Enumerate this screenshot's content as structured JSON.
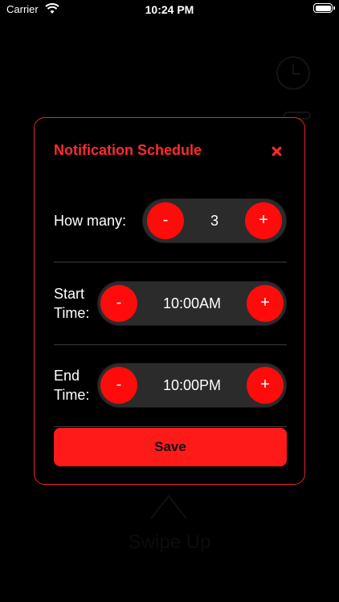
{
  "status_bar": {
    "carrier": "Carrier",
    "time": "10:24 PM"
  },
  "background": {
    "swipe_label": "Swipe Up"
  },
  "modal": {
    "title": "Notification Schedule",
    "rows": [
      {
        "label": "How many:",
        "minus": "-",
        "value": "3",
        "plus": "+"
      },
      {
        "label_line1": "Start",
        "label_line2": "Time:",
        "minus": "-",
        "value": "10:00AM",
        "plus": "+"
      },
      {
        "label_line1": "End",
        "label_line2": "Time:",
        "minus": "-",
        "value": "10:00PM",
        "plus": "+"
      }
    ],
    "save_label": "Save"
  },
  "colors": {
    "accent": "#ff1a1a",
    "title": "#ff2b2f",
    "stepper_bg": "#2b2b2b",
    "background": "#000000"
  }
}
